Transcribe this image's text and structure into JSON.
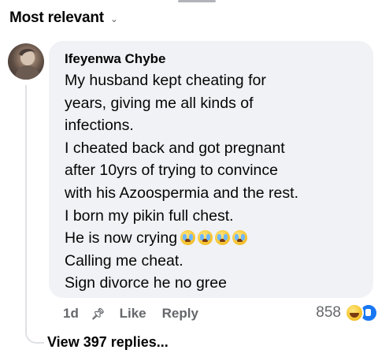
{
  "header": {
    "title": "Most relevant",
    "chevron": "chevron-down-icon"
  },
  "comment": {
    "author": "Ifeyenwa Chybe",
    "lines": [
      "My husband kept cheating for",
      "years, giving me all kinds of",
      "infections.",
      "I cheated back and got pregnant",
      "after 10yrs of trying to convince",
      "with his Azoospermia and the rest.",
      "I born my pikin full chest.",
      "He is now crying",
      "Calling me cheat.",
      "Sign divorce he no gree"
    ],
    "emoji": "crying-face-emoji",
    "emoji_count": 4
  },
  "actions": {
    "time": "1d",
    "like_label": "Like",
    "reply_label": "Reply",
    "reaction_count": "858",
    "reactions": [
      "haha-reaction",
      "like-reaction"
    ]
  },
  "view_replies": "View 397 replies...",
  "colors": {
    "bubble_bg": "#f0f2f5",
    "secondary_text": "#65676b",
    "primary_text": "#050505",
    "like_blue": "#1877f2"
  }
}
